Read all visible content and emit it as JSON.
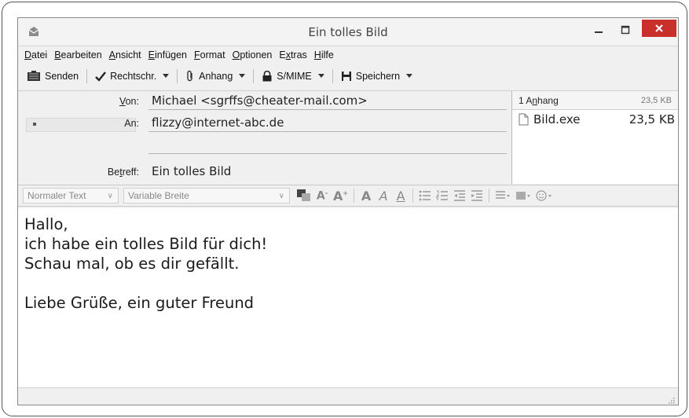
{
  "window": {
    "title": "Ein tolles Bild"
  },
  "menu": [
    {
      "acc": "D",
      "rest": "atei"
    },
    {
      "acc": "B",
      "rest": "earbeiten"
    },
    {
      "acc": "A",
      "rest": "nsicht"
    },
    {
      "acc": "E",
      "rest": "infügen"
    },
    {
      "acc": "F",
      "rest": "ormat"
    },
    {
      "acc": "O",
      "rest": "ptionen"
    },
    {
      "pre": "E",
      "acc": "x",
      "rest": "tras"
    },
    {
      "acc": "H",
      "rest": "ilfe"
    }
  ],
  "toolbar": {
    "send_label": "Senden",
    "spell_label": "Rechtschr.",
    "attach_label": "Anhang",
    "smime_label": "S/MIME",
    "save_label": "Speichern"
  },
  "header": {
    "from_label_acc": "V",
    "from_label_rest": "on:",
    "from_value": "Michael <sgrffs@cheater-mail.com>",
    "to_label": "An:",
    "to_value": "flizzy@internet-abc.de",
    "subject_label_pre": "Be",
    "subject_label_acc": "t",
    "subject_label_rest": "reff:",
    "subject_value": "Ein tolles Bild"
  },
  "attachments": {
    "header_count_pre": "1 A",
    "header_count_acc": "n",
    "header_count_rest": "hang",
    "header_size": "23,5 KB",
    "files": [
      {
        "name": "Bild.exe",
        "size": "23,5 KB"
      }
    ]
  },
  "format_bar": {
    "paragraph_format": "Normaler Text",
    "font": "Variable Breite"
  },
  "body": {
    "lines": [
      "Hallo,",
      "ich habe ein tolles Bild für dich!",
      "Schau mal, ob es dir gefällt.",
      "",
      "Liebe Grüße, ein guter Freund"
    ]
  },
  "colors": {
    "close_button": "#c9302c",
    "window_bg": "#f0f0f0",
    "body_bg": "#ffffff"
  },
  "icons": [
    "app-icon",
    "minimize-icon",
    "maximize-icon",
    "close-icon",
    "send-icon",
    "spellcheck-icon",
    "paperclip-icon",
    "lock-icon",
    "save-icon",
    "file-icon",
    "resize-grip-icon"
  ]
}
